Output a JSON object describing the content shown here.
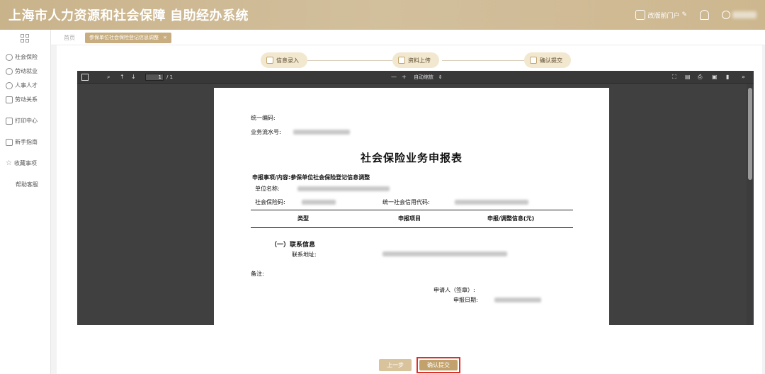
{
  "app": {
    "title_main": "上海市人力资源和社会保障",
    "title_sub": "自助经办系统",
    "header_actions": {
      "switch_portal": "改版前门户",
      "user_name": ""
    }
  },
  "sidebar": {
    "items": [
      {
        "label": "社会保险",
        "icon": "social-insurance-icon"
      },
      {
        "label": "劳动就业",
        "icon": "employment-icon"
      },
      {
        "label": "人事人才",
        "icon": "talent-icon"
      },
      {
        "label": "劳动关系",
        "icon": "labor-relation-icon"
      },
      {
        "label": "打印中心",
        "icon": "printer-icon"
      },
      {
        "label": "新手指南",
        "icon": "guide-icon"
      },
      {
        "label": "收藏事项",
        "icon": "star-icon"
      },
      {
        "label": "帮助客服",
        "icon": ""
      }
    ]
  },
  "tabs": {
    "home": "首页",
    "active": "参保单位社会保险登记信息调整",
    "close": "×"
  },
  "steps": [
    {
      "label": "信息录入"
    },
    {
      "label": "资料上传"
    },
    {
      "label": "确认提交"
    }
  ],
  "viewer": {
    "page_input": "1",
    "page_count": "/ 1",
    "zoom_minus": "—",
    "zoom_plus": "+",
    "zoom_label": "自动缩放",
    "zoom_arrow": "⇕",
    "scroll_fraction": 0.38
  },
  "document": {
    "unified_code_label": "统一编码:",
    "serial_label": "业务流水号:",
    "title": "社会保险业务申报表",
    "matter_label": "申报事项/内容:",
    "matter_value": "参保单位社会保险登记信息调整",
    "unit_name_label": "单位名称:",
    "insurance_code_label": "社会保险码:",
    "credit_code_label": "统一社会信用代码:",
    "col_type": "类型",
    "col_item": "申报项目",
    "col_info": "申报/调整信息(元)",
    "section_contact": "（一）联系信息",
    "contact_address_label": "联系地址:",
    "remark_label": "备注:",
    "applicant_label": "申请人（签章）:",
    "date_label": "申报日期:"
  },
  "buttons": {
    "prev": "上一步",
    "confirm": "确认提交"
  },
  "colors": {
    "header": "#cdb78f",
    "step_bg": "#f2e7cf",
    "primary_button": "#c2a26c",
    "highlight_border": "#d8322a"
  }
}
